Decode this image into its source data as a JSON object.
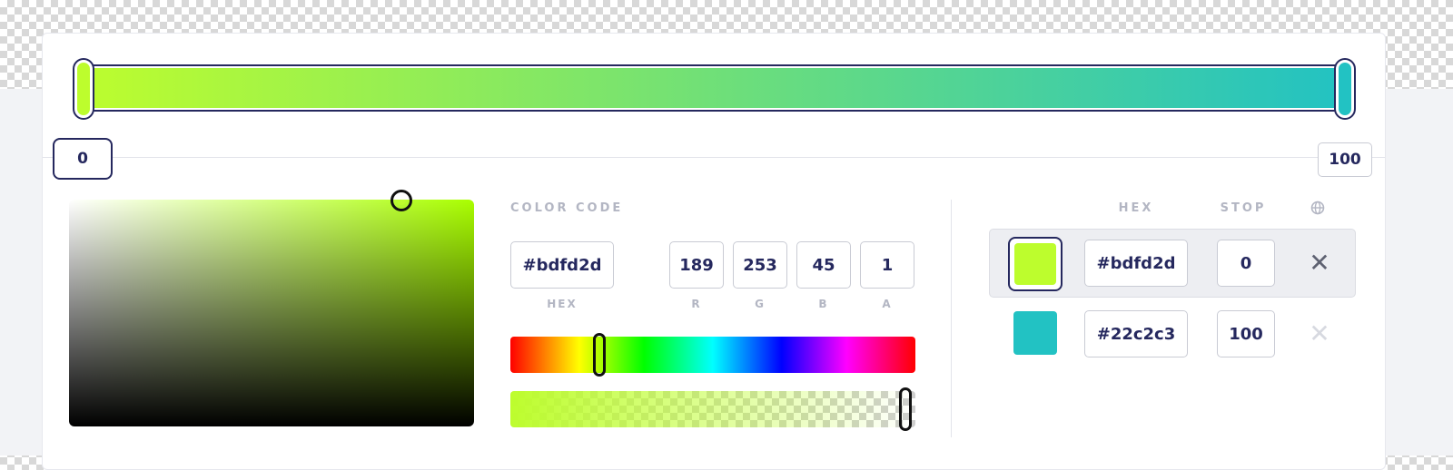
{
  "gradient": {
    "stops": [
      {
        "color": "#bdfd2d",
        "position": "0"
      },
      {
        "color": "#22c2c3",
        "position": "100"
      }
    ]
  },
  "picker": {
    "hue_degrees": 79,
    "saturation_percent": 82,
    "value_percent": 99,
    "base_hue_color": "#aaff00"
  },
  "color_code": {
    "section_label": "COLOR CODE",
    "hex": "#bdfd2d",
    "hex_label": "HEX",
    "r": "189",
    "r_label": "R",
    "g": "253",
    "g_label": "G",
    "b": "45",
    "b_label": "B",
    "a": "1",
    "a_label": "A"
  },
  "sliders": {
    "hue_fraction": 0.22,
    "alpha_fraction": 1.0
  },
  "stops_table": {
    "hex_header": "HEX",
    "stop_header": "STOP",
    "globe_icon": "globe-icon",
    "delete_icon": "close-icon",
    "rows": [
      {
        "color": "#bdfd2d",
        "hex": "#bdfd2d",
        "stop": "0",
        "active": true
      },
      {
        "color": "#22c2c3",
        "hex": "#22c2c3",
        "stop": "100",
        "active": false
      }
    ]
  },
  "colors": {
    "accent": "#25285e",
    "muted_label": "#b3b6c3",
    "delete_active": "#5f6272",
    "delete_disabled": "#d7d9e0"
  }
}
